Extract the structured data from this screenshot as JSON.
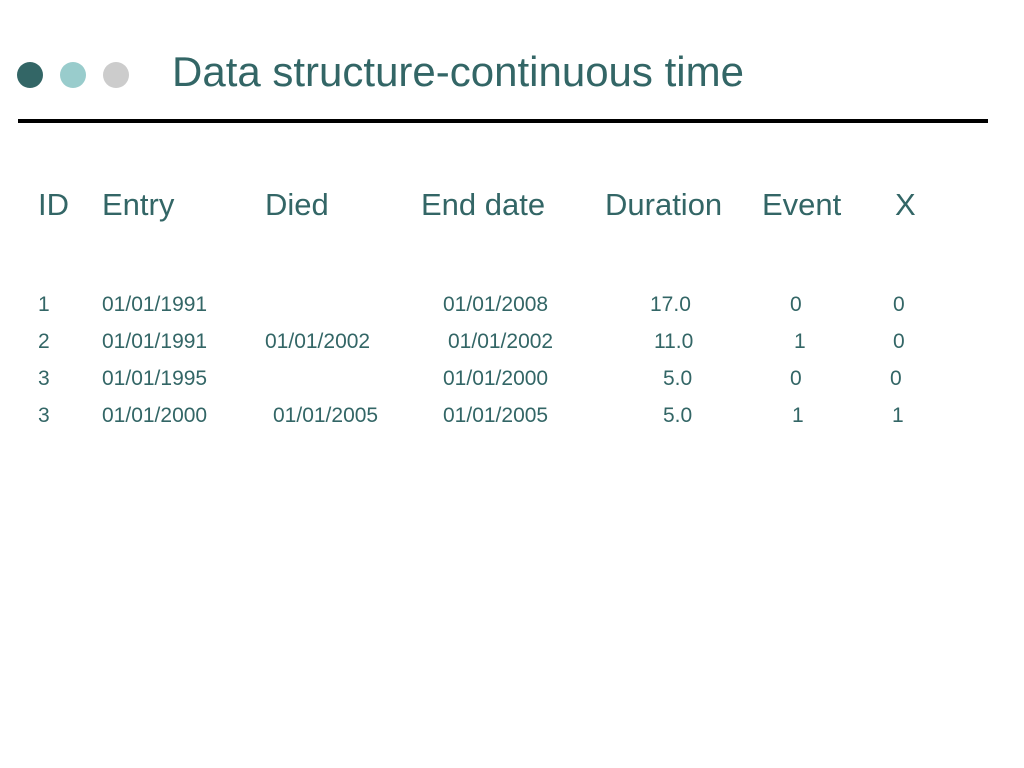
{
  "slide": {
    "title": "Data structure-continuous time",
    "bullets": [
      {
        "name": "dark-teal-dot",
        "color": "#336666"
      },
      {
        "name": "light-teal-dot",
        "color": "#99cccc"
      },
      {
        "name": "grey-dot",
        "color": "#cccccc"
      }
    ]
  },
  "table": {
    "headers": [
      "ID",
      "Entry",
      "Died",
      "End date",
      "Duration",
      "Event",
      "X"
    ],
    "rows": [
      [
        "1",
        "01/01/1991",
        "",
        "01/01/2008",
        "17.0",
        "0",
        "0"
      ],
      [
        "2",
        "01/01/1991",
        "01/01/2002",
        "01/01/2002",
        "11.0",
        "1",
        "0"
      ],
      [
        "3",
        "01/01/1995",
        "",
        "01/01/2000",
        "5.0",
        "0",
        "0"
      ],
      [
        "3",
        "01/01/2000",
        "01/01/2005",
        "01/01/2005",
        "5.0",
        "1",
        "1"
      ]
    ]
  }
}
